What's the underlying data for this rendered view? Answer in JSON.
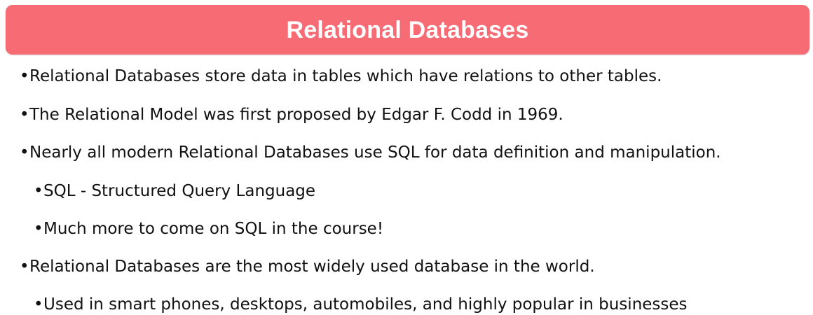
{
  "slide": {
    "title": "Relational Databases",
    "colors": {
      "title_bar": "#f76b75",
      "title_text": "#ffffff",
      "body_text": "#111111",
      "background": "#ffffff"
    },
    "bullets": [
      {
        "level": 1,
        "text": "Relational Databases store data in tables which have relations to other tables."
      },
      {
        "level": 1,
        "text": "The Relational Model was first proposed by Edgar F. Codd in 1969."
      },
      {
        "level": 1,
        "text": "Nearly all modern Relational Databases use SQL for data definition and manipulation."
      },
      {
        "level": 2,
        "text": "SQL - Structured Query Language"
      },
      {
        "level": 2,
        "text": "Much more to come on SQL in the course!"
      },
      {
        "level": 1,
        "text": "Relational Databases are the most widely used database in the world."
      },
      {
        "level": 2,
        "text": "Used in smart phones, desktops, automobiles, and highly popular in businesses"
      }
    ]
  }
}
